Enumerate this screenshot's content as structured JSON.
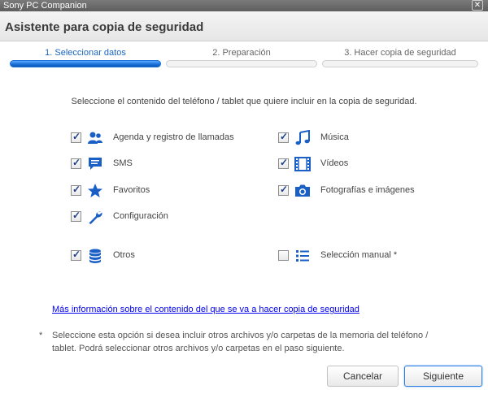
{
  "window": {
    "title": "Sony PC Companion",
    "close_glyph": "✕"
  },
  "header": {
    "title": "Asistente para copia de seguridad"
  },
  "steps": [
    {
      "label": "1. Seleccionar datos",
      "active": true
    },
    {
      "label": "2. Preparación",
      "active": false
    },
    {
      "label": "3. Hacer copia de seguridad",
      "active": false
    }
  ],
  "instructions": "Seleccione el contenido del teléfono / tablet que quiere incluir en la copia de seguridad.",
  "options": {
    "contacts": {
      "label": "Agenda y registro de llamadas",
      "checked": true,
      "icon": "contacts-icon"
    },
    "sms": {
      "label": "SMS",
      "checked": true,
      "icon": "message-icon"
    },
    "favorites": {
      "label": "Favoritos",
      "checked": true,
      "icon": "star-icon"
    },
    "settings": {
      "label": "Configuración",
      "checked": true,
      "icon": "wrench-icon"
    },
    "others": {
      "label": "Otros",
      "checked": true,
      "icon": "database-icon"
    },
    "music": {
      "label": "Música",
      "checked": true,
      "icon": "music-note-icon"
    },
    "videos": {
      "label": "Vídeos",
      "checked": true,
      "icon": "film-icon"
    },
    "photos": {
      "label": "Fotografías e imágenes",
      "checked": true,
      "icon": "camera-icon"
    },
    "manual": {
      "label": "Selección manual *",
      "checked": false,
      "icon": "list-icon"
    }
  },
  "more_info_link": "Más información sobre el contenido del que se va a hacer copia de seguridad",
  "footnote": {
    "marker": "*",
    "text": "Seleccione esta opción si desea incluir otros archivos y/o carpetas de la memoria del teléfono / tablet. Podrá seleccionar otros archivos y/o carpetas en el paso siguiente."
  },
  "buttons": {
    "cancel": "Cancelar",
    "next": "Siguiente"
  },
  "colors": {
    "accent": "#1a6fd6",
    "icon_blue": "#1a5fc6",
    "link": "#0000ee"
  }
}
